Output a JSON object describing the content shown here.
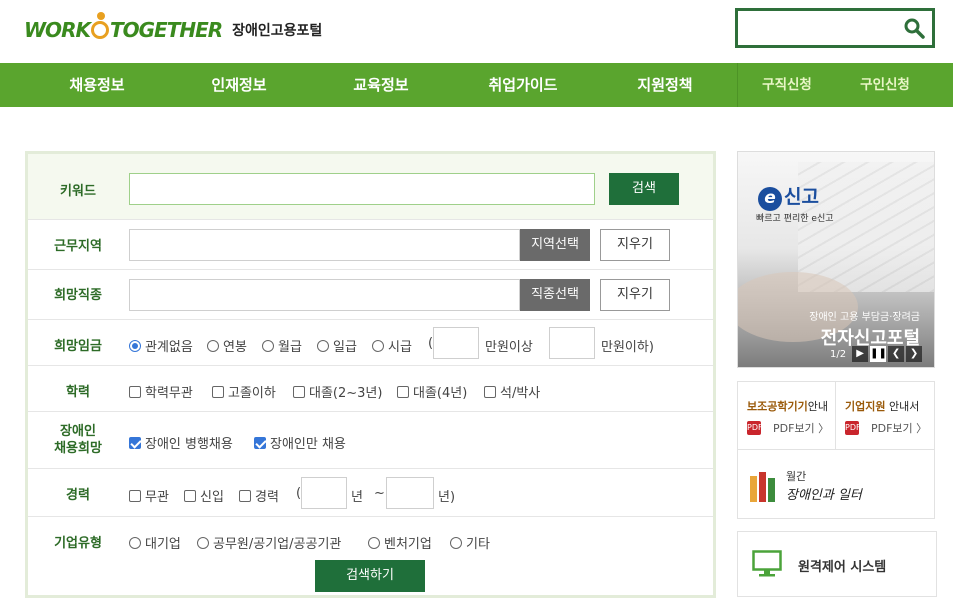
{
  "header": {
    "logo_main": "WORK TOGETHER",
    "logo_part1": "WORK",
    "logo_part2": "TOGETHER",
    "logo_sub": "장애인고용포털",
    "search_placeholder": ""
  },
  "nav": {
    "items": [
      "채용정보",
      "인재정보",
      "교육정보",
      "취업가이드",
      "지원정책"
    ],
    "sub_items": [
      "구직신청",
      "구인신청"
    ]
  },
  "form": {
    "keyword": {
      "label": "키워드",
      "value": "",
      "button": "검색"
    },
    "region": {
      "label": "근무지역",
      "select_button": "지역선택",
      "clear_button": "지우기"
    },
    "job": {
      "label": "희망직종",
      "select_button": "직종선택",
      "clear_button": "지우기"
    },
    "wage": {
      "label": "희망임금",
      "options": [
        "관계없음",
        "연봉",
        "월급",
        "일급",
        "시급"
      ],
      "selected": "관계없음",
      "open_paren": "(",
      "min_suffix": "만원이상",
      "max_suffix": "만원이하)"
    },
    "education": {
      "label": "학력",
      "options": [
        "학력무관",
        "고졸이하",
        "대졸(2~3년)",
        "대졸(4년)",
        "석/박사"
      ]
    },
    "disabled_hiring": {
      "label_line1": "장애인",
      "label_line2": "채용희망",
      "options": [
        "장애인 병행채용",
        "장애인만 채용"
      ],
      "checked": [
        true,
        true
      ]
    },
    "career": {
      "label": "경력",
      "options": [
        "무관",
        "신입",
        "경력"
      ],
      "open_paren": "(",
      "year1": "년",
      "tilde": "~",
      "year2": "년)"
    },
    "company_type": {
      "label": "기업유형",
      "options": [
        "대기업",
        "공무원/공기업/공공기관",
        "벤처기업",
        "기타"
      ]
    },
    "submit": "검색하기"
  },
  "banner": {
    "logo": "신고",
    "logo_e": "e",
    "logo_sub": "빠르고 편리한 e신고",
    "caption": "장애인 고용 부담금·장려금",
    "title": "전자신고포털",
    "page": "1/2",
    "controls": [
      "▶",
      "❚❚",
      "❮",
      "❯"
    ]
  },
  "guide": {
    "left_title_bold": "보조공학기기",
    "left_title_rest": "안내",
    "right_title_bold": "기업지원",
    "right_title_rest": " 안내서",
    "pdf_label": "PDF보기 〉",
    "pdf_icon": "PDF",
    "magazine_label": "월간",
    "magazine_title": "장애인과 일터"
  },
  "remote": {
    "label": "원격제어 시스템"
  }
}
